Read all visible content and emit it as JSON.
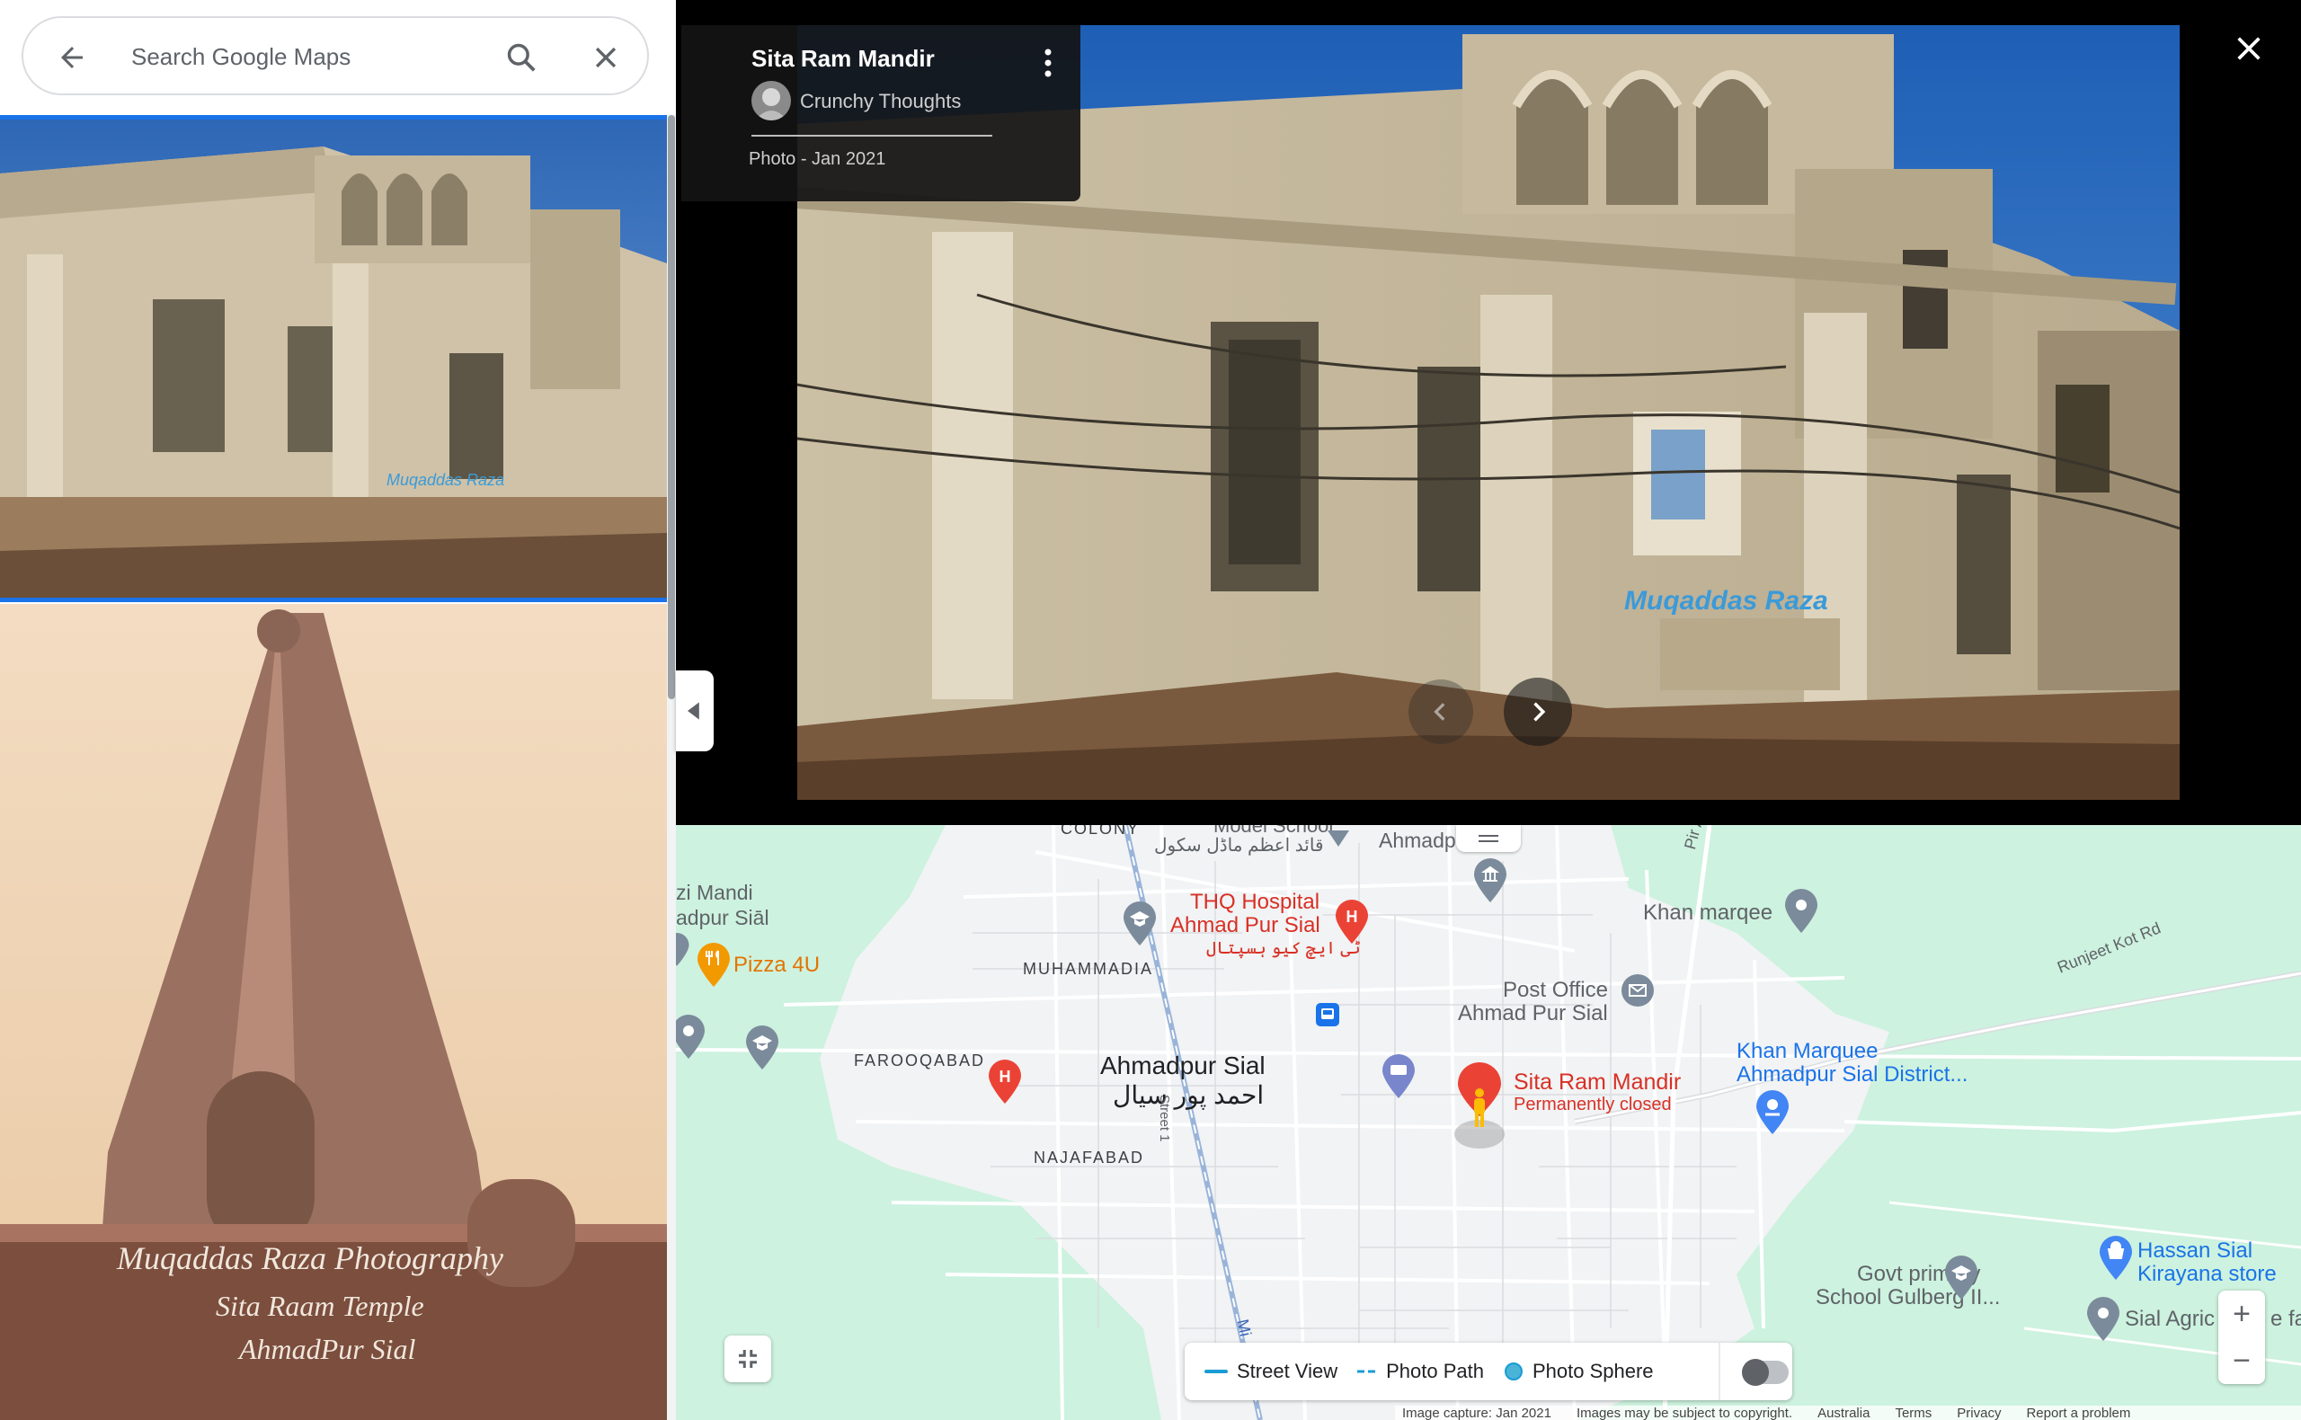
{
  "search": {
    "placeholder": "Search Google Maps"
  },
  "viewer": {
    "place_title": "Sita Ram Mandir",
    "author": "Crunchy Thoughts",
    "meta": "Photo - Jan 2021",
    "watermark": "Muqaddas Raza"
  },
  "thumb2_watermark": {
    "line1": "Muqaddas Raza Photography",
    "line2": "Sita Raam Temple",
    "line3": "AhmadPur Sial"
  },
  "map": {
    "areas": [
      "COLONY",
      "MUHAMMADIA",
      "FAROOQABAD",
      "NAJAFABAD"
    ],
    "labels": {
      "model_school": "Model School",
      "model_school_urdu": "قائد اعظم ماڈل سکول",
      "ahmadpur_top": "Ahmadpur Sial",
      "mandi_1": "zi Mandi",
      "mandi_2": "adpur Siāl",
      "thq_1": "THQ Hospital",
      "thq_2": "Ahmad Pur Sial",
      "thq_urdu": "ٹی ایچ کیو ہسپتال",
      "pizza": "Pizza 4U",
      "khan_marqee": "Khan marqee",
      "post_1": "Post Office",
      "post_2": "Ahmad Pur Sial",
      "city": "Ahmadpur Sial",
      "city_urdu": "احمد پور سیال",
      "street1": "Street 1",
      "sita": "Sita Ram Mandir",
      "closed": "Permanently closed",
      "khan_marquee_1": "Khan Marquee",
      "khan_marquee_2": "Ahmadpur Sial District...",
      "runjeet": "Runjeet Kot Rd",
      "pir": "Pir Ad",
      "govt_1": "Govt primary",
      "govt_2": "School Gulberg II...",
      "hassan_1": "Hassan Sial",
      "hassan_2": "Kirayana store",
      "sial_agri": "Sial Agric",
      "edge_fa": "e fa",
      "road_m": "Mi"
    },
    "legend": {
      "street_view": "Street View",
      "photo_path": "Photo Path",
      "photo_sphere": "Photo Sphere"
    },
    "zoom_in": "+",
    "zoom_out": "−",
    "attribution": [
      "Image capture: Jan 2021",
      "Images may be subject to copyright.",
      "Australia",
      "Terms",
      "Privacy",
      "Report a problem"
    ]
  },
  "colors": {
    "accent": "#1a73e8",
    "map_green": "#cdf2df",
    "map_urban": "#f1f3f4",
    "poi_red": "#ea4335"
  }
}
